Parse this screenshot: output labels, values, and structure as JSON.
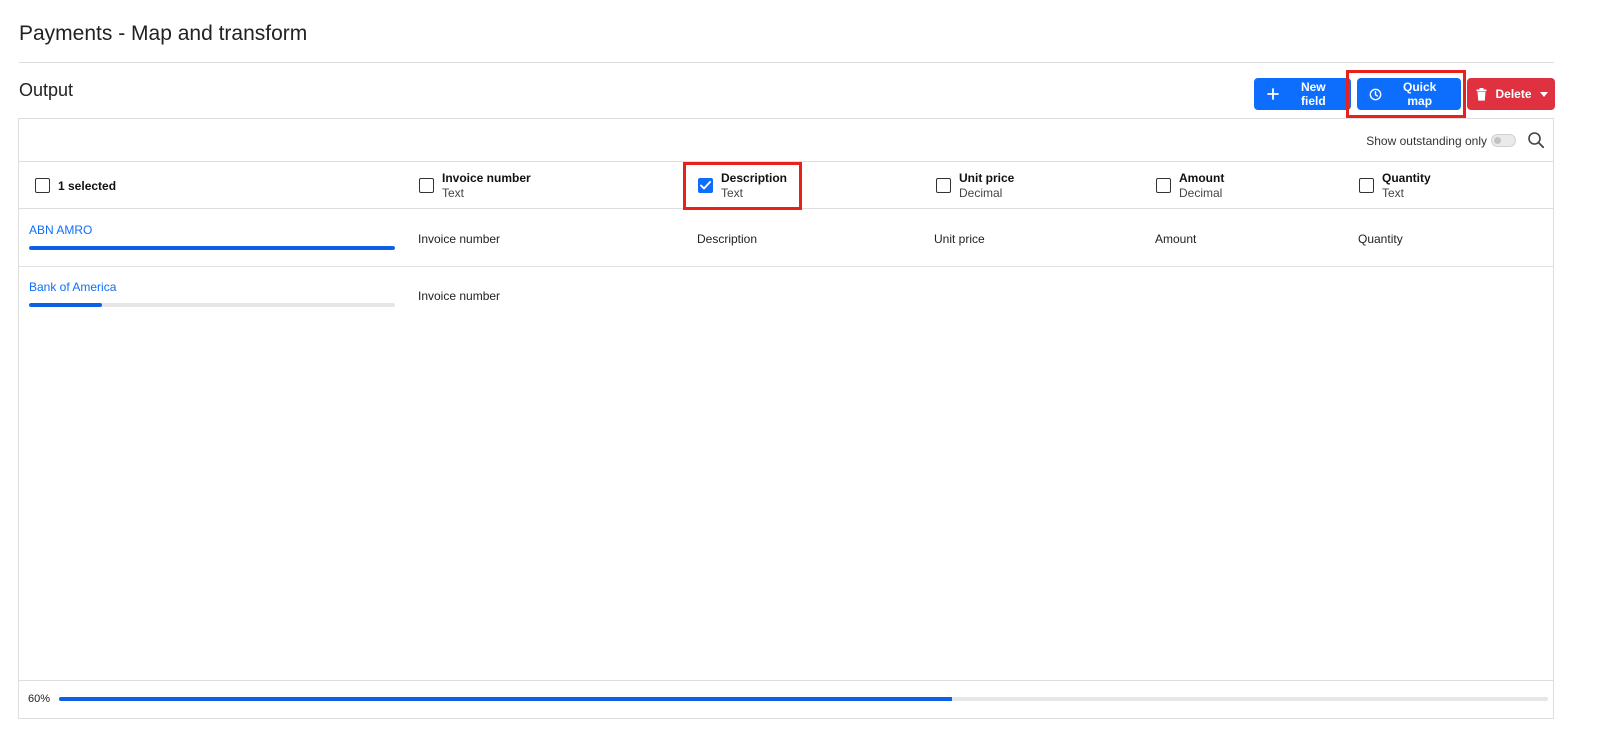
{
  "page": {
    "title": "Payments - Map and transform"
  },
  "output": {
    "title": "Output",
    "toolbar": {
      "new_field_label": "New field",
      "quick_map_label": "Quick map",
      "delete_label": "Delete"
    },
    "filter": {
      "show_outstanding_label": "Show outstanding only",
      "show_outstanding_on": false
    },
    "selection": {
      "count_label": "1 selected"
    },
    "columns": [
      {
        "name": "Invoice number",
        "type": "Text",
        "checked": false
      },
      {
        "name": "Description",
        "type": "Text",
        "checked": true
      },
      {
        "name": "Unit price",
        "type": "Decimal",
        "checked": false
      },
      {
        "name": "Amount",
        "type": "Decimal",
        "checked": false
      },
      {
        "name": "Quantity",
        "type": "Text",
        "checked": false
      }
    ],
    "rows": [
      {
        "name": "ABN AMRO",
        "progress": 1.0,
        "cells": [
          "Invoice number",
          "Description",
          "Unit price",
          "Amount",
          "Quantity"
        ]
      },
      {
        "name": "Bank of America",
        "progress": 0.2,
        "cells": [
          "Invoice number"
        ]
      }
    ],
    "overall_progress": {
      "label": "60%",
      "value": 0.6
    }
  },
  "colors": {
    "primary": "#0d6efd",
    "danger": "#e03140",
    "highlight": "#e8211d"
  },
  "icons": {
    "new_field": "plus-icon",
    "quick_map": "clock-icon",
    "delete": "trash-icon",
    "delete_caret": "caret-down-icon",
    "search": "search-icon",
    "check": "check-icon"
  }
}
